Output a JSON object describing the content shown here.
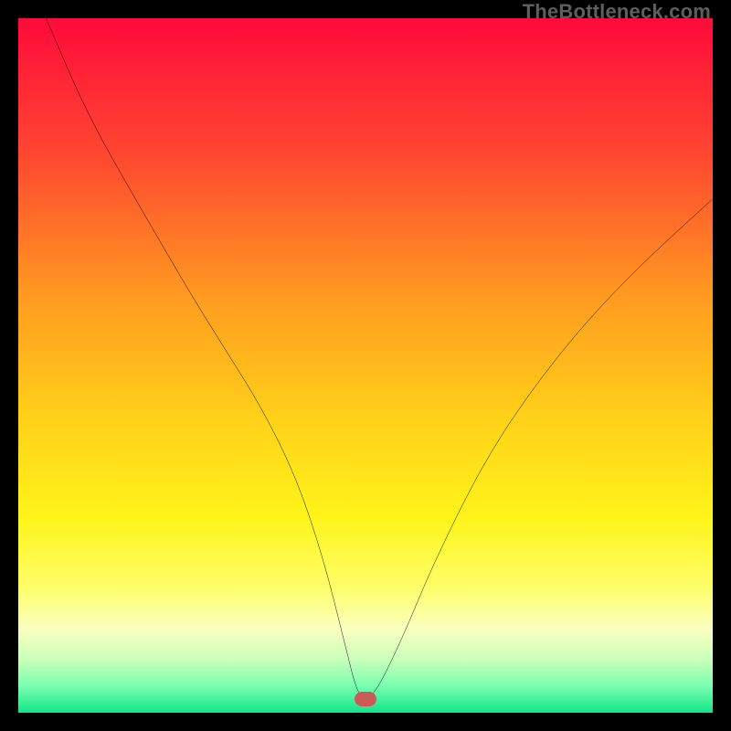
{
  "watermark": "TheBottleneck.com",
  "marker": {
    "color": "#cc5a5a"
  },
  "gradient_stops": [
    {
      "pct": 0,
      "color": "#ff0a3a"
    },
    {
      "pct": 20,
      "color": "#ff4830"
    },
    {
      "pct": 40,
      "color": "#ff9a20"
    },
    {
      "pct": 58,
      "color": "#ffd219"
    },
    {
      "pct": 72,
      "color": "#fff41a"
    },
    {
      "pct": 82,
      "color": "#fdff6a"
    },
    {
      "pct": 88,
      "color": "#f8ffc0"
    },
    {
      "pct": 92,
      "color": "#cfffbb"
    },
    {
      "pct": 96,
      "color": "#7dffb0"
    },
    {
      "pct": 100,
      "color": "#12e58a"
    }
  ],
  "chart_data": {
    "type": "line",
    "title": "",
    "xlabel": "",
    "ylabel": "",
    "xlim": [
      0,
      100
    ],
    "ylim": [
      0,
      100
    ],
    "grid": false,
    "legend": false,
    "annotations": [
      "TheBottleneck.com"
    ],
    "background": "red-yellow-green vertical gradient (bottleneck heat scale)",
    "marker_value": {
      "x": 50,
      "y": 2
    },
    "series": [
      {
        "name": "bottleneck-curve",
        "x": [
          4,
          10,
          18,
          25,
          30,
          35,
          40,
          44,
          47,
          49,
          51,
          55,
          60,
          68,
          78,
          88,
          100
        ],
        "y": [
          100,
          86,
          72,
          60,
          52,
          44,
          34,
          22,
          10,
          2,
          2,
          10,
          22,
          38,
          52,
          63,
          74
        ]
      }
    ]
  }
}
